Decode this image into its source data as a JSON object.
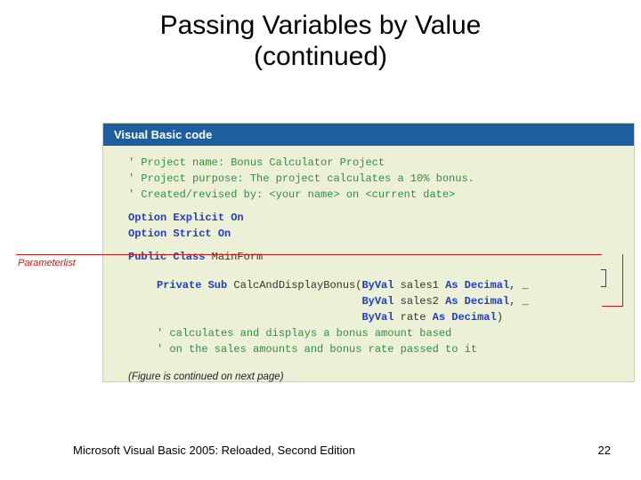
{
  "title_line1": "Passing Variables by Value",
  "title_line2": "(continued)",
  "banner": "Visual Basic code",
  "comments": {
    "l1": "' Project name:        Bonus Calculator Project",
    "l2": "' Project purpose:     The project calculates a 10% bonus.",
    "l3": "' Created/revised by:  <your name> on <current date>"
  },
  "kw": {
    "option_explicit": "Option Explicit On",
    "option_strict": "Option Strict On",
    "public": "Public Class",
    "class_name": " MainForm",
    "private_sub": "Private Sub",
    "sub_name": " CalcAndDisplayBonus(",
    "byval": "ByVal",
    "as_decimal": "As Decimal"
  },
  "params": {
    "p1_name": " sales1 ",
    "p2_name": " sales2 ",
    "p3_name": " rate ",
    "comma_cont": ", _",
    "close": ")"
  },
  "sub_comments": {
    "c1": "' calculates and displays a bonus amount based",
    "c2": "' on the sales amounts and bonus rate passed to it"
  },
  "annot": {
    "parameterlist": "Parameterlist"
  },
  "cont_note": "(Figure is continued on next page)",
  "footer_left": "Microsoft Visual Basic 2005: Reloaded, Second Edition",
  "footer_right": "22"
}
